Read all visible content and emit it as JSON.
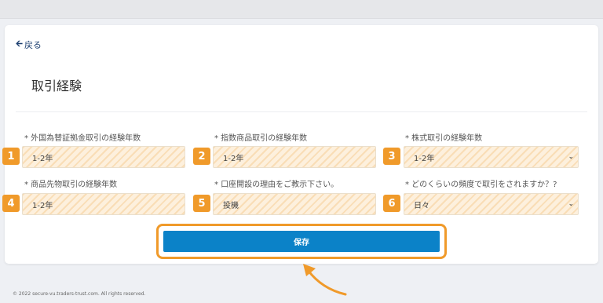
{
  "back_label": "戻る",
  "page_title": "取引経験",
  "fields": [
    {
      "badge": "1",
      "label": "* 外国為替証拠金取引の経験年数",
      "value": "1-2年",
      "select": false
    },
    {
      "badge": "2",
      "label": "* 指数商品取引の経験年数",
      "value": "1-2年",
      "select": false
    },
    {
      "badge": "3",
      "label": "* 株式取引の経験年数",
      "value": "1-2年",
      "select": true
    },
    {
      "badge": "4",
      "label": "* 商品先物取引の経験年数",
      "value": "1-2年",
      "select": false
    },
    {
      "badge": "5",
      "label": "* 口座開設の理由をご教示下さい。",
      "value": "投機",
      "select": false
    },
    {
      "badge": "6",
      "label": "* どのくらいの頻度で取引をされますか？?",
      "value": "日々",
      "select": true
    }
  ],
  "save_label": "保存",
  "footer": "© 2022 secure-vu.traders-trust.com. All rights reserved.",
  "colors": {
    "accent": "#f09a2a",
    "button": "#0b82c8",
    "field_bg": "#fdf0dd",
    "link": "#1c3f70"
  }
}
